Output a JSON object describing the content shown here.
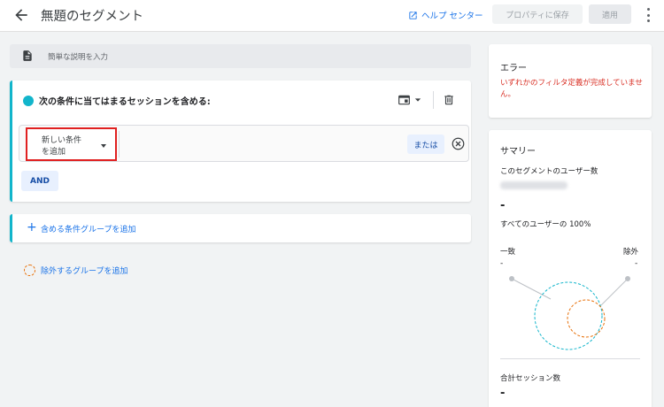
{
  "header": {
    "title": "無題のセグメント",
    "help_label": "ヘルプ センター",
    "save_label": "プロパティに保存",
    "apply_label": "適用"
  },
  "description": {
    "placeholder": "簡単な説明を入力"
  },
  "condition_group": {
    "title": "次の条件に当てはまるセッションを含める:",
    "accent_color": "#12b5cb",
    "new_condition_label": "新しい条件\nを追加",
    "or_label": "または",
    "and_label": "AND"
  },
  "add_include_group": {
    "label": "含める条件グループを追加"
  },
  "add_exclude_group": {
    "label": "除外するグループを追加",
    "accent_color": "#e8710a"
  },
  "error_panel": {
    "title": "エラー",
    "message": "いずれかのフィルタ定義が完成していません。",
    "color": "#d93025"
  },
  "summary": {
    "title": "サマリー",
    "users_label": "このセグメントのユーザー数",
    "users_value": "-",
    "all_users_label": "すべてのユーザーの 100%",
    "match_label": "一致",
    "match_value": "-",
    "exclude_label": "除外",
    "exclude_value": "-",
    "sessions_label": "合計セッション数",
    "sessions_value": "-"
  },
  "icons": {
    "back": "arrow-back-icon",
    "help": "open-external-icon",
    "more": "more-vert-icon",
    "description": "document-icon",
    "card_view": "card-view-icon",
    "delete": "trash-icon",
    "remove": "close-circle-icon",
    "add": "plus-icon"
  }
}
